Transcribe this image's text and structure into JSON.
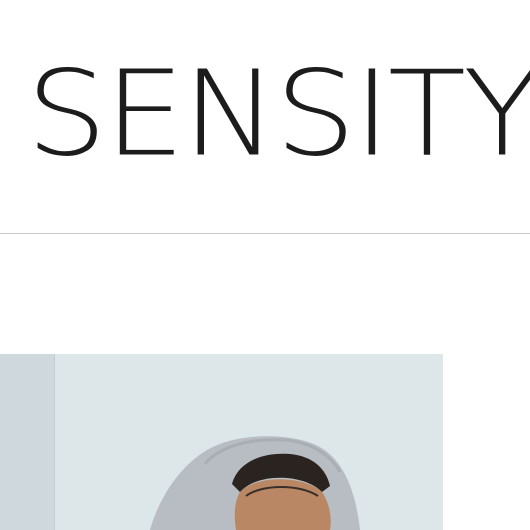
{
  "header": {
    "brand_title": "SENSITY A"
  },
  "hero": {
    "image_subject": "person-wearing-grey-hood",
    "colors": {
      "backdrop": "#dde6e9",
      "wall_shadow": "#cdd7db",
      "hood": "#b9bec4",
      "hair": "#2a2320",
      "skin": "#b98764"
    }
  }
}
